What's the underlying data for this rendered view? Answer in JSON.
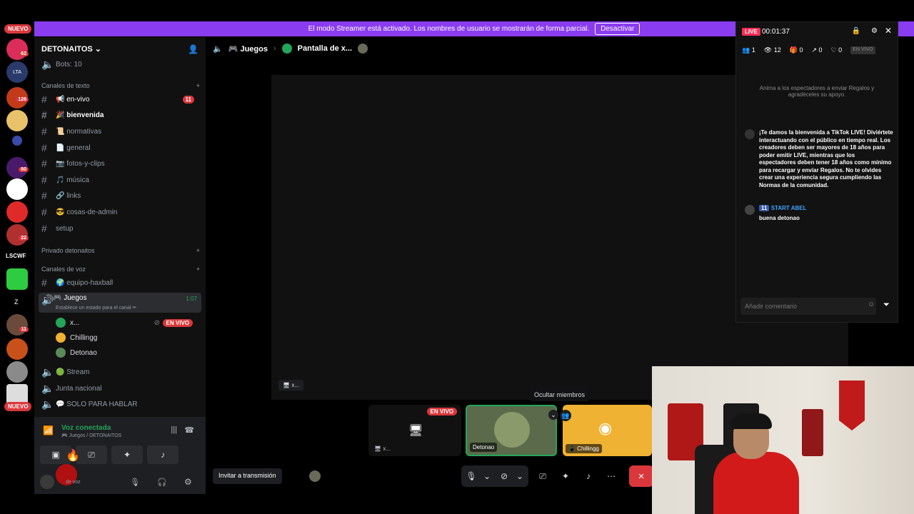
{
  "banner": {
    "text": "El modo Streamer está activado. Los nombres de usuario se mostrarán de forma parcial.",
    "button": "Desactivar"
  },
  "rail": {
    "nuevo_top": "NUEVO",
    "nuevo_bottom": "NUEVO",
    "badges": [
      "62",
      "126",
      "60",
      "22",
      "11"
    ],
    "labels": [
      "LTA",
      "LSCWF",
      "Z"
    ]
  },
  "sidebar": {
    "guild": "DETONAITOS",
    "bots": "Bots: 10",
    "cat_text": "Canales de texto",
    "channels": [
      {
        "name": "📢 en-vivo",
        "count": "11"
      },
      {
        "name": "🎉 bienvenida"
      },
      {
        "name": "📜 normativas"
      },
      {
        "name": "📄 general"
      },
      {
        "name": "📷 fotos-y-clips"
      },
      {
        "name": "🎵 música"
      },
      {
        "name": "🔗 links"
      },
      {
        "name": "😎 cosas-de-admin"
      },
      {
        "name": "setup"
      }
    ],
    "cat_private": "Privado detonaitos",
    "cat_voice": "Canales de voz",
    "voice_channels": [
      {
        "name": "🌍 equipo-haxball"
      },
      {
        "name": "🎮 Juegos",
        "time": "1:07",
        "status": "Establece un estado para el canal ✏"
      },
      {
        "name": "🟢 Stream"
      },
      {
        "name": "Junta nacional"
      },
      {
        "name": "💬 SOLO PARA HABLAR"
      }
    ],
    "voice_members": [
      {
        "name": "x...",
        "live": "EN VIVO"
      },
      {
        "name": "Chillingg"
      },
      {
        "name": "Detonao"
      }
    ],
    "voice_connected": "Voz conectada",
    "voice_sub": "🎮 Juegos / DETONAITOS",
    "user_status": "de voz"
  },
  "main": {
    "channel": "🎮 Juegos",
    "stream_title": "Pantalla de x...",
    "stage_tag": "🖥 x...",
    "tooltip": "Ocultar miembros",
    "tiles": [
      {
        "name": "🖥 x...",
        "live": "EN VIVO"
      },
      {
        "name": "Detonao"
      },
      {
        "name": "📱 Chillingg"
      }
    ],
    "invite": "Invitar a transmisión"
  },
  "tiktok": {
    "live": "LIVE",
    "time": "00:01:37",
    "stats": [
      "1",
      "12",
      "0",
      "0",
      "0"
    ],
    "envivo": "EN VIVO",
    "hint": "Anima a los espectadores a enviar Regalos y agradéceles su apoyo.",
    "welcome": "¡Te damos la bienvenida a TikTok LIVE! Diviértete interactuando con el público en tiempo real. Los creadores deben ser mayores de 18 años para poder emitir LIVE, mientras que los espectadores deben tener 18 años como mínimo para recargar y enviar Regalos. No te olvides crear una experiencia segura cumpliendo las Normas de la comunidad.",
    "user_level": "11",
    "user": "START ABEL",
    "comment": "buena detonao",
    "input_placeholder": "Añadir comentario"
  }
}
